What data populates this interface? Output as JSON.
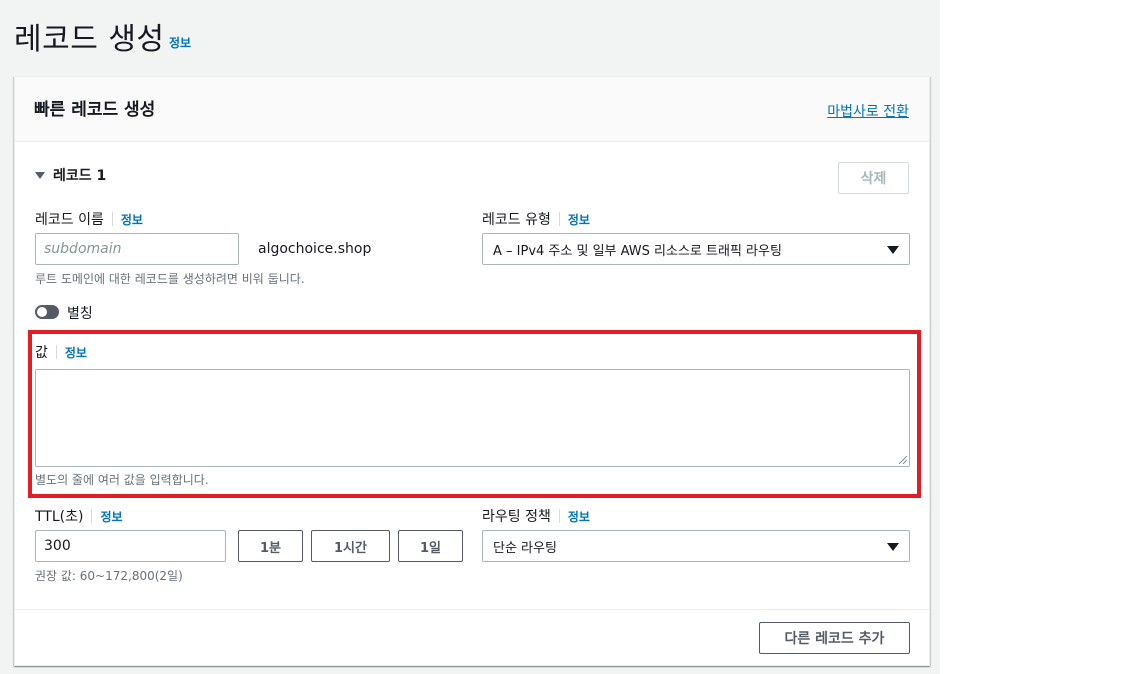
{
  "page": {
    "title": "레코드 생성",
    "info_label": "정보"
  },
  "panel": {
    "title": "빠른 레코드 생성",
    "wizard_link": "마법사로 전환"
  },
  "record": {
    "header": "레코드 1",
    "delete_label": "삭제",
    "name": {
      "label": "레코드 이름",
      "info": "정보",
      "placeholder": "subdomain",
      "value": "",
      "domain_suffix": "algochoice.shop",
      "hint": "루트 도메인에 대한 레코드를 생성하려면 비워 둡니다."
    },
    "type": {
      "label": "레코드 유형",
      "info": "정보",
      "selected": "A – IPv4 주소 및 일부 AWS 리소스로 트래픽 라우팅"
    },
    "alias": {
      "label": "별칭",
      "enabled": false
    },
    "value": {
      "label": "값",
      "info": "정보",
      "content": "",
      "hint": "별도의 줄에 여러 값을 입력합니다."
    },
    "ttl": {
      "label": "TTL(초)",
      "info": "정보",
      "value": "300",
      "quick_buttons": [
        "1분",
        "1시간",
        "1일"
      ],
      "hint": "권장 값: 60~172,800(2일)"
    },
    "routing": {
      "label": "라우팅 정책",
      "info": "정보",
      "selected": "단순 라우팅"
    }
  },
  "footer": {
    "add_record_label": "다른 레코드 추가"
  },
  "colors": {
    "link": "#0073bb",
    "highlight": "#e11d26",
    "page_bg": "#f2f3f3"
  }
}
